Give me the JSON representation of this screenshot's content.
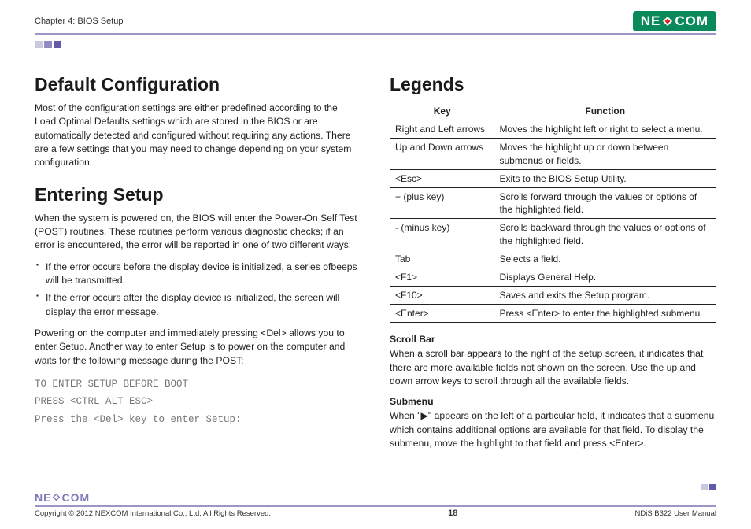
{
  "header": {
    "chapter": "Chapter 4: BIOS Setup",
    "brand1": "NE",
    "brand2": "COM"
  },
  "left": {
    "h1": "Default Configuration",
    "p1": "Most of the configuration settings are either predefined according to the Load Optimal Defaults settings which are stored in the BIOS or are automatically detected and configured without requiring any actions. There are a few settings that you may need to change depending on your system configuration.",
    "h2": "Entering Setup",
    "p2": "When the system is powered on, the BIOS will enter the Power-On Self Test (POST) routines. These routines perform various diagnostic checks; if an error is encountered, the error will be reported in one of two different ways:",
    "li1": "If the error occurs before the display device is initialized, a series ofbeeps will be transmitted.",
    "li2": "If the error occurs after the display device is initialized, the screen will display the error message.",
    "p3": "Powering on the computer and immediately pressing <Del> allows you to enter Setup. Another way to enter Setup is to power on the computer and waits for the following message during the POST:",
    "m1": "TO ENTER SETUP BEFORE BOOT",
    "m2": "PRESS <CTRL-ALT-ESC>",
    "m3": "Press the <Del> key to enter Setup:"
  },
  "right": {
    "h1": "Legends",
    "thKey": "Key",
    "thFunc": "Function",
    "rows": [
      {
        "k": "Right and Left arrows",
        "f": "Moves the highlight left or right to select a menu."
      },
      {
        "k": "Up and Down arrows",
        "f": "Moves the highlight up or down between submenus or fields."
      },
      {
        "k": "<Esc>",
        "f": "Exits to the BIOS Setup Utility."
      },
      {
        "k": "+ (plus key)",
        "f": "Scrolls forward through the values or options of the highlighted field."
      },
      {
        "k": "- (minus key)",
        "f": "Scrolls backward through the values or options of the highlighted field."
      },
      {
        "k": "Tab",
        "f": "Selects a field."
      },
      {
        "k": "<F1>",
        "f": "Displays General Help."
      },
      {
        "k": "<F10>",
        "f": "Saves and exits the Setup program."
      },
      {
        "k": "<Enter>",
        "f": "Press <Enter> to enter the highlighted submenu."
      }
    ],
    "sb_h": "Scroll Bar",
    "sb_p": "When a scroll bar appears to the right of the setup screen, it indicates that there are more available fields not shown on the screen. Use the up and down arrow keys to scroll through all the available fields.",
    "sm_h": "Submenu",
    "sm_p": "When \"▶\" appears on the left of a particular field, it indicates that a submenu which contains additional options are available for that field. To display the submenu, move the highlight to that field and press <Enter>."
  },
  "footer": {
    "copyright": "Copyright © 2012 NEXCOM International Co., Ltd. All Rights Reserved.",
    "page": "18",
    "manual": "NDiS B322 User Manual"
  }
}
